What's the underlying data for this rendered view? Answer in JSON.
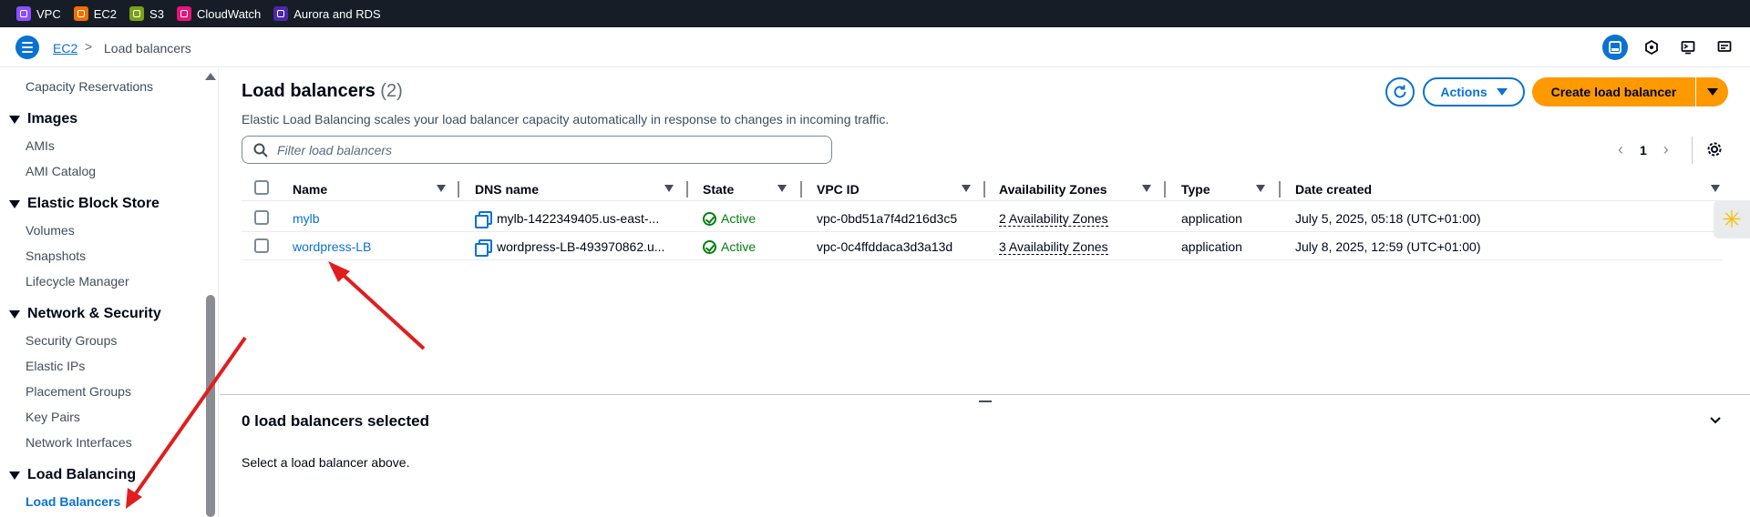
{
  "favorites": [
    {
      "label": "VPC",
      "color": "#8c4fff",
      "icon": "vpc-icon"
    },
    {
      "label": "EC2",
      "color": "#ed7100",
      "icon": "ec2-icon"
    },
    {
      "label": "S3",
      "color": "#7aa116",
      "icon": "s3-icon"
    },
    {
      "label": "CloudWatch",
      "color": "#e7157b",
      "icon": "cloudwatch-icon"
    },
    {
      "label": "Aurora and RDS",
      "color": "#4d27aa",
      "icon": "rds-icon"
    }
  ],
  "breadcrumb": {
    "root": "EC2",
    "separator": ">",
    "current": "Load balancers"
  },
  "sidebar": {
    "items_top": [
      "Capacity Reservations"
    ],
    "sections": [
      {
        "title": "Images",
        "items": [
          "AMIs",
          "AMI Catalog"
        ]
      },
      {
        "title": "Elastic Block Store",
        "items": [
          "Volumes",
          "Snapshots",
          "Lifecycle Manager"
        ]
      },
      {
        "title": "Network & Security",
        "items": [
          "Security Groups",
          "Elastic IPs",
          "Placement Groups",
          "Key Pairs",
          "Network Interfaces"
        ]
      },
      {
        "title": "Load Balancing",
        "items": [
          "Load Balancers"
        ]
      }
    ],
    "active_item": "Load Balancers"
  },
  "main": {
    "title": "Load balancers",
    "count": "(2)",
    "description": "Elastic Load Balancing scales your load balancer capacity automatically in response to changes in incoming traffic.",
    "actions_label": "Actions",
    "create_label": "Create load balancer",
    "filter_placeholder": "Filter load balancers",
    "page": "1",
    "columns": [
      "Name",
      "DNS name",
      "State",
      "VPC ID",
      "Availability Zones",
      "Type",
      "Date created"
    ],
    "rows": [
      {
        "name": "mylb",
        "dns": "mylb-1422349405.us-east-...",
        "state": "Active",
        "vpc": "vpc-0bd51a7f4d216d3c5",
        "az": "2 Availability Zones",
        "type": "application",
        "created": "July 5, 2025, 05:18 (UTC+01:00)"
      },
      {
        "name": "wordpress-LB",
        "dns": "wordpress-LB-493970862.u...",
        "state": "Active",
        "vpc": "vpc-0c4ffddaca3d3a13d",
        "az": "3 Availability Zones",
        "type": "application",
        "created": "July 8, 2025, 12:59 (UTC+01:00)"
      }
    ]
  },
  "details": {
    "title": "0 load balancers selected",
    "message": "Select a load balancer above."
  },
  "colors": {
    "accent": "#0972d3",
    "primary_button": "#ff9900",
    "status_ok": "#037f0c",
    "topbar": "#161d26",
    "annotation_arrow": "#e01e1e"
  }
}
